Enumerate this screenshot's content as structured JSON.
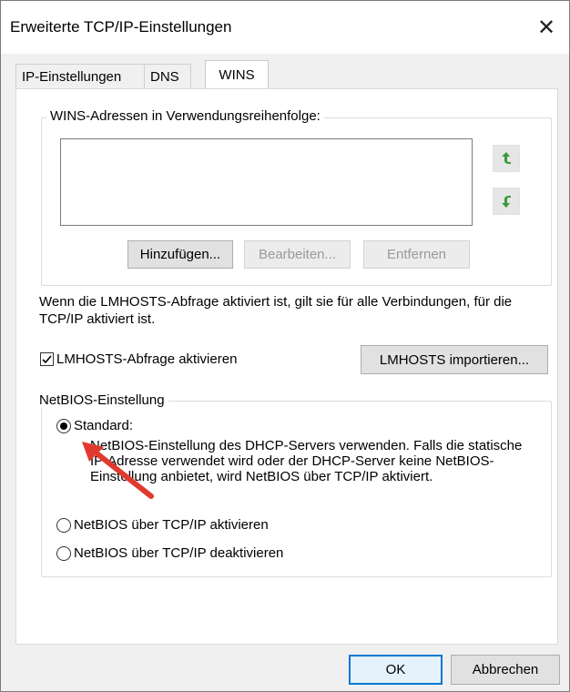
{
  "window": {
    "title": "Erweiterte TCP/IP-Einstellungen",
    "close_glyph": "✕"
  },
  "tabs": [
    {
      "label": "IP-Einstellungen",
      "active": false
    },
    {
      "label": "DNS",
      "active": false
    },
    {
      "label": "WINS",
      "active": true
    }
  ],
  "wins_group": {
    "legend": "WINS-Adressen in Verwendungsreihenfolge:",
    "add_label": "Hinzufügen...",
    "edit_label": "Bearbeiten...",
    "remove_label": "Entfernen",
    "up_icon": "arrow-up-icon",
    "down_icon": "arrow-down-icon"
  },
  "lmhosts": {
    "info": "Wenn die LMHOSTS-Abfrage aktiviert ist, gilt sie für alle Verbindungen, für die TCP/IP aktiviert ist.",
    "checkbox_label": "LMHOSTS-Abfrage aktivieren",
    "checked": true,
    "import_label": "LMHOSTS importieren..."
  },
  "netbios": {
    "legend": "NetBIOS-Einstellung",
    "options": [
      {
        "label": "Standard:",
        "selected": true
      },
      {
        "label": "NetBIOS über TCP/IP aktivieren",
        "selected": false
      },
      {
        "label": "NetBIOS über TCP/IP deaktivieren",
        "selected": false
      }
    ],
    "standard_description": "NetBIOS-Einstellung des DHCP-Servers verwenden. Falls die statische IP-Adresse verwendet wird oder der DHCP-Server keine NetBIOS-Einstellung anbietet, wird NetBIOS über TCP/IP aktiviert."
  },
  "footer": {
    "ok_label": "OK",
    "cancel_label": "Abbrechen"
  },
  "colors": {
    "arrow_green": "#3a9a3a",
    "annotation_red": "#e03a2f",
    "focus_blue": "#0078d7"
  }
}
